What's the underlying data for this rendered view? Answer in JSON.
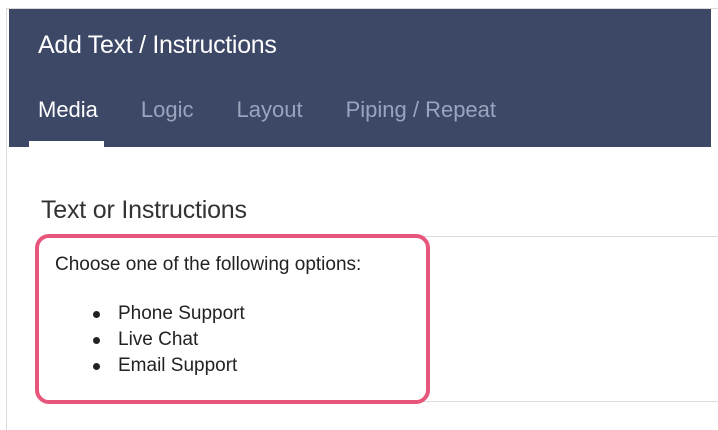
{
  "dialog": {
    "title": "Add Text / Instructions",
    "tabs": [
      {
        "label": "Media",
        "active": true
      },
      {
        "label": "Logic",
        "active": false
      },
      {
        "label": "Layout",
        "active": false
      },
      {
        "label": "Piping / Repeat",
        "active": false
      }
    ]
  },
  "content": {
    "section_title": "Text or Instructions",
    "lead_text": "Choose one of the following options:",
    "options": [
      "Phone Support",
      "Live Chat",
      "Email Support"
    ]
  },
  "colors": {
    "header_bg": "#3d4867",
    "highlight_border": "#e8567c"
  }
}
